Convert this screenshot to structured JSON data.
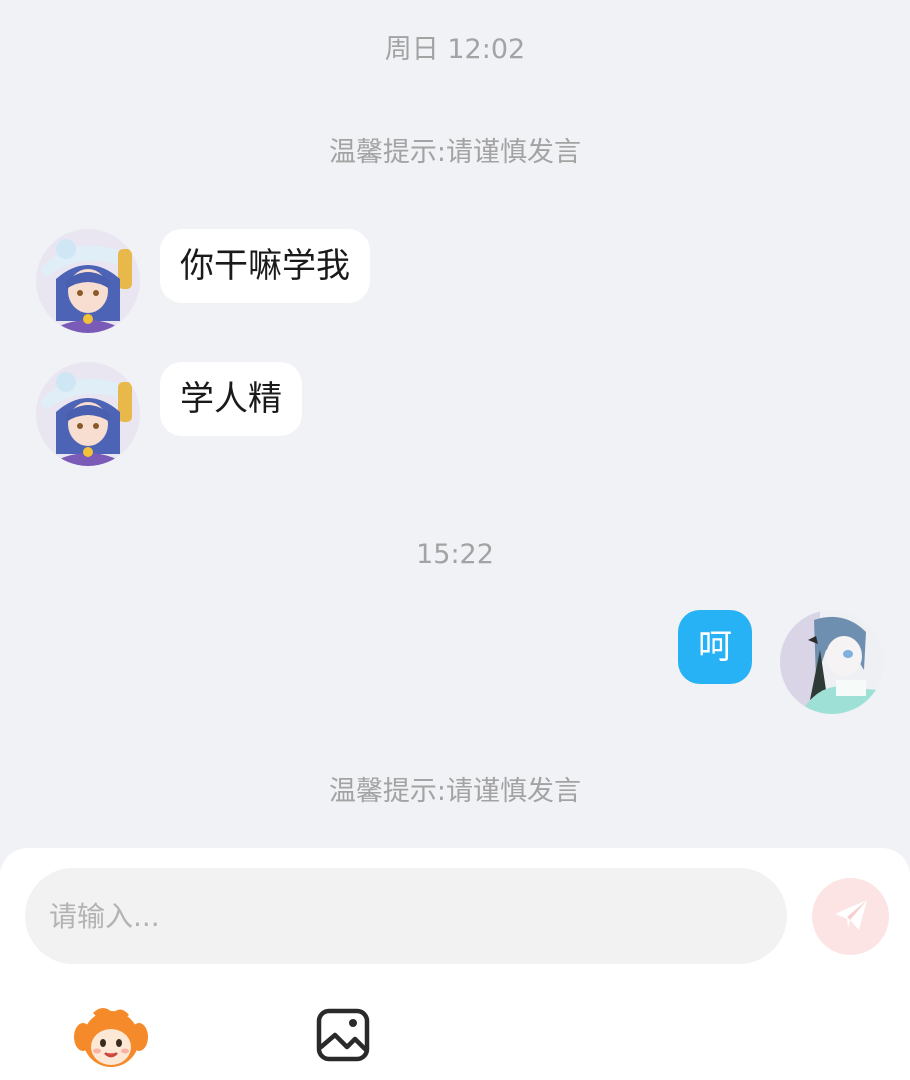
{
  "chat": {
    "timestamps": [
      "周日 12:02",
      "15:22"
    ],
    "notice": "温馨提示:请谨慎发言",
    "messages": [
      {
        "sender": "other",
        "text": "你干嘛学我"
      },
      {
        "sender": "other",
        "text": "学人精"
      },
      {
        "sender": "self",
        "text": "呵"
      }
    ]
  },
  "composer": {
    "placeholder": "请输入...",
    "send_icon": "paper-plane-icon",
    "tools": [
      "emoji-mascot-icon",
      "image-icon"
    ]
  },
  "colors": {
    "background": "#f0f2f5",
    "self_bubble": "#27b2f5",
    "other_bubble": "#ffffff",
    "send_button": "#fde4e4"
  }
}
